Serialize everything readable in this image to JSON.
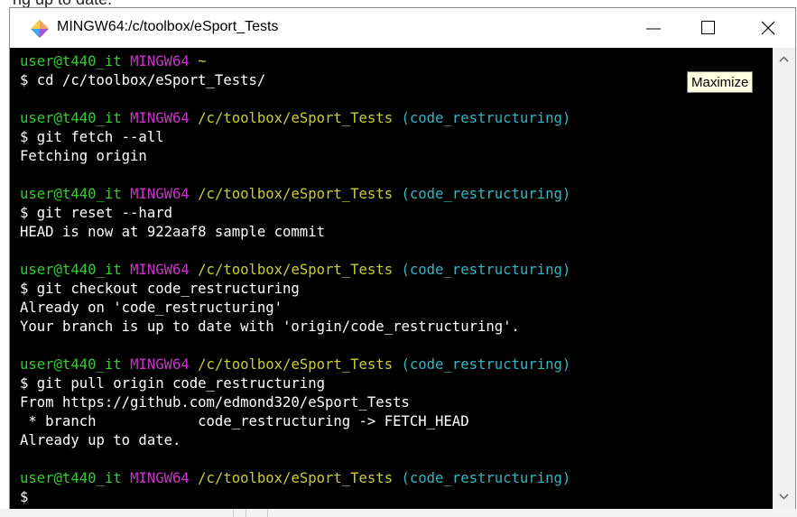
{
  "background": {
    "partial_text": "ng up to date."
  },
  "window": {
    "title": "MINGW64:/c/toolbox/eSport_Tests",
    "tooltip": "Maximize"
  },
  "colors": {
    "terminal_bg": "#000000",
    "user_host": "#33cc33",
    "shell_name": "#cc33cc",
    "path": "#cccc33",
    "branch": "#33b5c0",
    "output": "#ffffff"
  },
  "terminal": {
    "prompts": [
      {
        "user": "user@t440_it",
        "shell": "MINGW64",
        "path": "~",
        "branch": ""
      },
      {
        "user": "user@t440_it",
        "shell": "MINGW64",
        "path": "/c/toolbox/eSport_Tests",
        "branch": "(code_restructuring)"
      },
      {
        "user": "user@t440_it",
        "shell": "MINGW64",
        "path": "/c/toolbox/eSport_Tests",
        "branch": "(code_restructuring)"
      },
      {
        "user": "user@t440_it",
        "shell": "MINGW64",
        "path": "/c/toolbox/eSport_Tests",
        "branch": "(code_restructuring)"
      },
      {
        "user": "user@t440_it",
        "shell": "MINGW64",
        "path": "/c/toolbox/eSport_Tests",
        "branch": "(code_restructuring)"
      },
      {
        "user": "user@t440_it",
        "shell": "MINGW64",
        "path": "/c/toolbox/eSport_Tests",
        "branch": "(code_restructuring)"
      }
    ],
    "commands": [
      "$ cd /c/toolbox/eSport_Tests/",
      "$ git fetch --all",
      "$ git reset --hard",
      "$ git checkout code_restructuring",
      "$ git pull origin code_restructuring",
      "$"
    ],
    "outputs": [
      "Fetching origin",
      "HEAD is now at 922aaf8 sample commit",
      "Already on 'code_restructuring'",
      "Your branch is up to date with 'origin/code_restructuring'.",
      "From https://github.com/edmond320/eSport_Tests",
      " * branch            code_restructuring -> FETCH_HEAD",
      "Already up to date."
    ]
  }
}
